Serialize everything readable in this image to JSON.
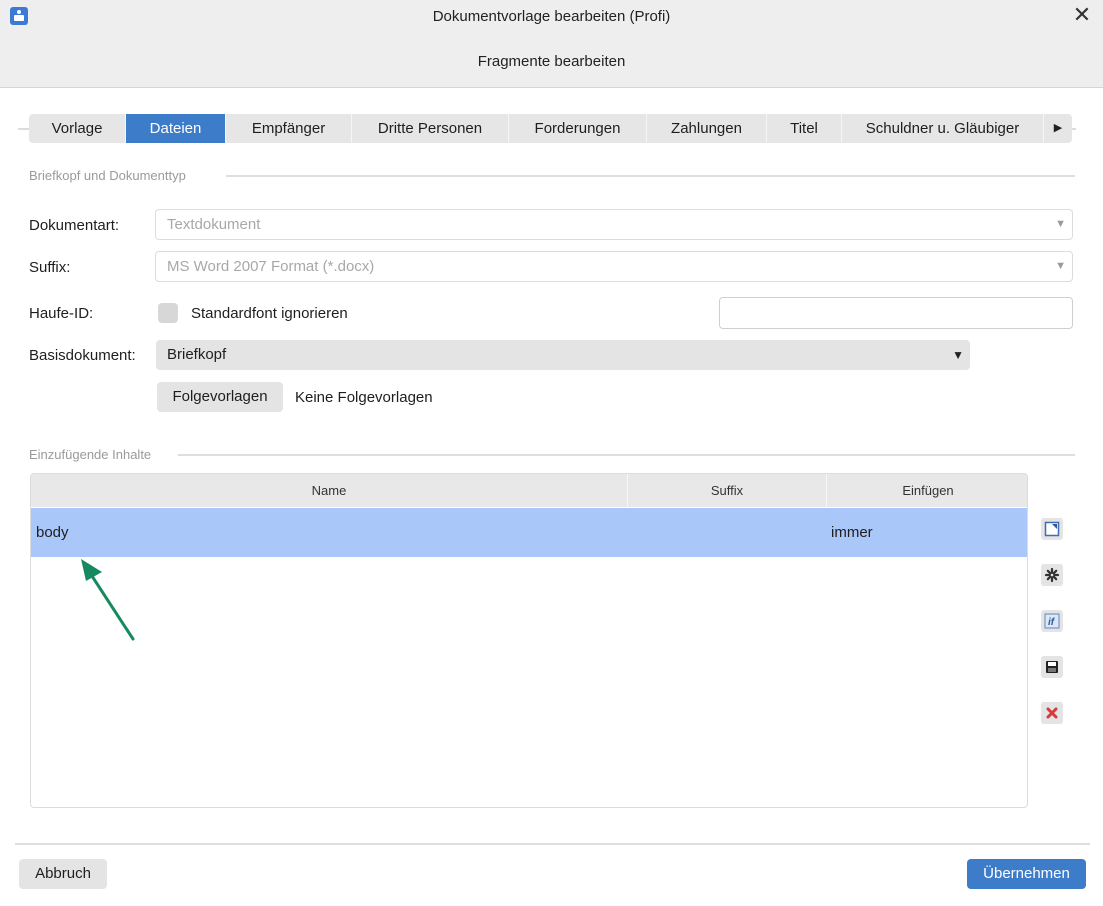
{
  "window": {
    "title": "Dokumentvorlage bearbeiten (Profi)",
    "subtitle": "Fragmente bearbeiten",
    "close_glyph": "✕"
  },
  "tabs": [
    {
      "label": "Vorlage",
      "active": false
    },
    {
      "label": "Dateien",
      "active": true
    },
    {
      "label": "Empfänger",
      "active": false
    },
    {
      "label": "Dritte Personen",
      "active": false
    },
    {
      "label": "Forderungen",
      "active": false
    },
    {
      "label": "Zahlungen",
      "active": false
    },
    {
      "label": "Titel",
      "active": false
    },
    {
      "label": "Schuldner u. Gläubiger",
      "active": false
    }
  ],
  "tabs_more_glyph": "▶",
  "section1": {
    "title": "Briefkopf und Dokumenttyp",
    "dokumentart_label": "Dokumentart:",
    "dokumentart_value": "Textdokument",
    "suffix_label": "Suffix:",
    "suffix_value": "MS Word 2007 Format (*.docx)",
    "haufe_label": "Haufe-ID:",
    "standardfont_label": "Standardfont ignorieren",
    "standardfont_checked": false,
    "haufe_value": "",
    "basisdokument_label": "Basisdokument:",
    "basisdokument_value": "Briefkopf",
    "folgevorlagen_button": "Folgevorlagen",
    "folgevorlagen_status": "Keine Folgevorlagen"
  },
  "section2": {
    "title": "Einzufügende Inhalte",
    "columns": [
      "Name",
      "Suffix",
      "Einfügen"
    ],
    "rows": [
      {
        "name": "body",
        "suffix": "",
        "einfuegen": "immer",
        "selected": true
      }
    ]
  },
  "side_icons": [
    "edit-icon",
    "gear-icon",
    "if-condition-icon",
    "save-icon",
    "delete-icon"
  ],
  "footer": {
    "cancel_label": "Abbruch",
    "apply_label": "Übernehmen"
  },
  "colors": {
    "accent": "#3d7cc9",
    "selected_row": "#a9c7f8",
    "annotation_arrow": "#168a5e",
    "delete_red": "#d63a3a"
  }
}
